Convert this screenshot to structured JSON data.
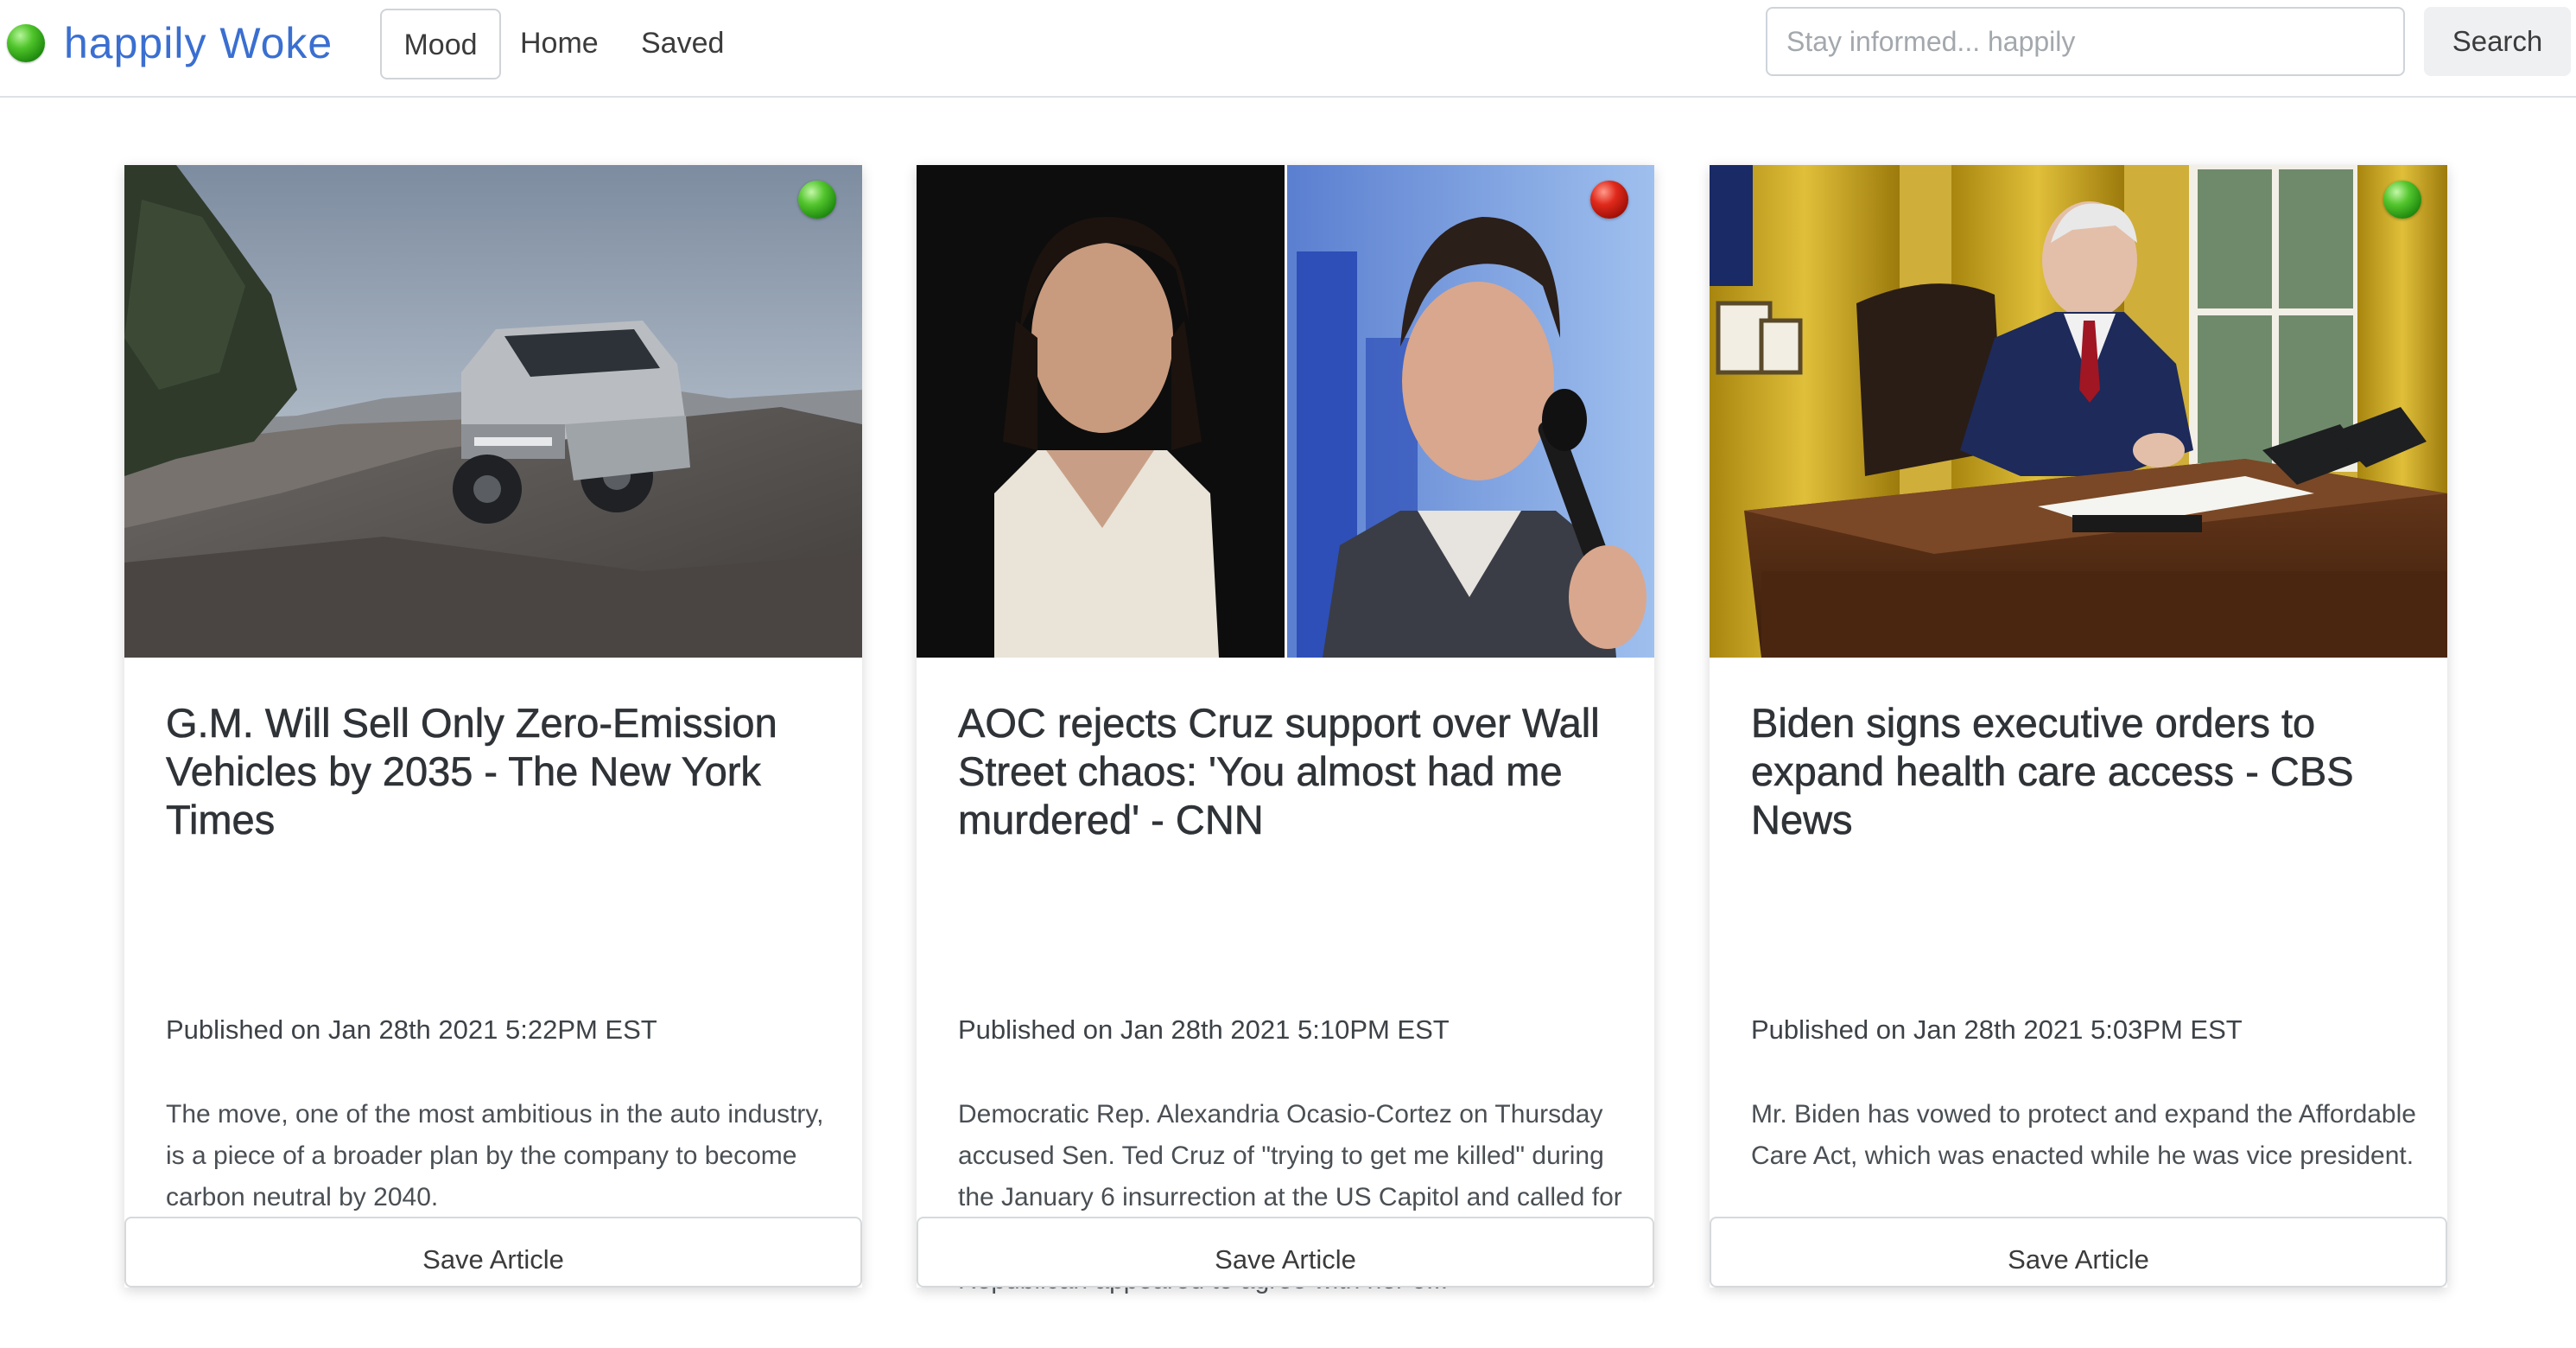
{
  "brand": {
    "name": "happily Woke"
  },
  "nav": {
    "mood_label": "Mood",
    "home_label": "Home",
    "saved_label": "Saved"
  },
  "search": {
    "placeholder": "Stay informed... happily",
    "value": "",
    "button_label": "Search"
  },
  "colors": {
    "brand": "#3a6fd1",
    "mood_good": "#3fb31c",
    "mood_bad": "#c8140a"
  },
  "articles": [
    {
      "mood": "good",
      "mood_icon": "green-dot-icon",
      "image": "gmc-hummer-ev-on-canyon-cliff",
      "title": "G.M. Will Sell Only Zero-Emission Vehicles by 2035 - The New York Times",
      "published": "Published on Jan 28th 2021 5:22PM EST",
      "summary": "The move, one of the most ambitious in the auto industry, is a piece of a broader plan by the company to become carbon neutral by 2040.",
      "save_label": "Save Article"
    },
    {
      "mood": "bad",
      "mood_icon": "red-dot-icon",
      "image": "split-portrait-aoc-and-cruz",
      "title": "AOC rejects Cruz support over Wall Street chaos: 'You almost had me murdered' - CNN",
      "published": "Published on Jan 28th 2021 5:10PM EST",
      "summary": "Democratic Rep. Alexandria Ocasio-Cortez on Thursday accused Sen. Ted Cruz of \"trying to get me killed\" during the January 6 insurrection at the US Capitol and called for his resignation from the Senate, after the Texas Republican appeared to agree with her o...",
      "save_label": "Save Article"
    },
    {
      "mood": "good",
      "mood_icon": "green-dot-icon",
      "image": "biden-signing-at-oval-office-desk",
      "title": "Biden signs executive orders to expand health care access - CBS News",
      "published": "Published on Jan 28th 2021 5:03PM EST",
      "summary": "Mr. Biden has vowed to protect and expand the Affordable Care Act, which was enacted while he was vice president.",
      "save_label": "Save Article"
    }
  ]
}
